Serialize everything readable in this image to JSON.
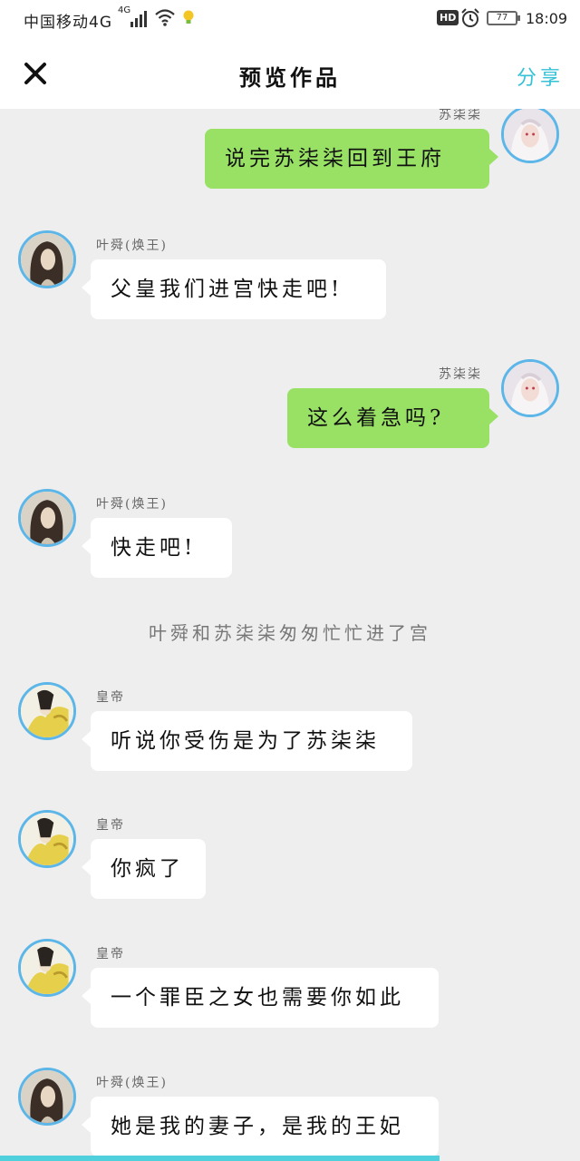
{
  "status_bar": {
    "carrier": "中国移动4G",
    "network": "4G",
    "hd": "HD",
    "battery": "77",
    "time": "18:09"
  },
  "nav": {
    "close_icon": "close-icon",
    "title": "预览作品",
    "share": "分享",
    "accent_color": "#35c2d6"
  },
  "messages": [
    {
      "side": "right",
      "name": "苏柒柒",
      "text": "说完苏柒柒回到王府",
      "avatar": "white-hair-girl-avatar"
    },
    {
      "side": "left",
      "name": "叶舜(焕王)",
      "text": "父皇我们进宫快走吧!",
      "avatar": "dark-hair-man-avatar"
    },
    {
      "side": "right",
      "name": "苏柒柒",
      "text": "这么着急吗?",
      "avatar": "white-hair-girl-avatar"
    },
    {
      "side": "left",
      "name": "叶舜(焕王)",
      "text": "快走吧!",
      "avatar": "dark-hair-man-avatar"
    },
    {
      "type": "narration",
      "text": "叶舜和苏柒柒匆匆忙忙进了宫"
    },
    {
      "side": "left",
      "name": "皇帝",
      "text": "听说你受伤是为了苏柒柒",
      "avatar": "yellow-robe-emperor-avatar"
    },
    {
      "side": "left",
      "name": "皇帝",
      "text": "你疯了",
      "avatar": "yellow-robe-emperor-avatar"
    },
    {
      "side": "left",
      "name": "皇帝",
      "text": "一个罪臣之女也需要你如此",
      "avatar": "yellow-robe-emperor-avatar"
    },
    {
      "side": "left",
      "name": "叶舜(焕王)",
      "text": "她是我的妻子，是我的王妃",
      "avatar": "dark-hair-man-avatar"
    }
  ],
  "colors": {
    "right_bubble": "#98e165",
    "left_bubble": "#ffffff",
    "avatar_ring": "#5db6e8",
    "background": "#eeeeee"
  }
}
